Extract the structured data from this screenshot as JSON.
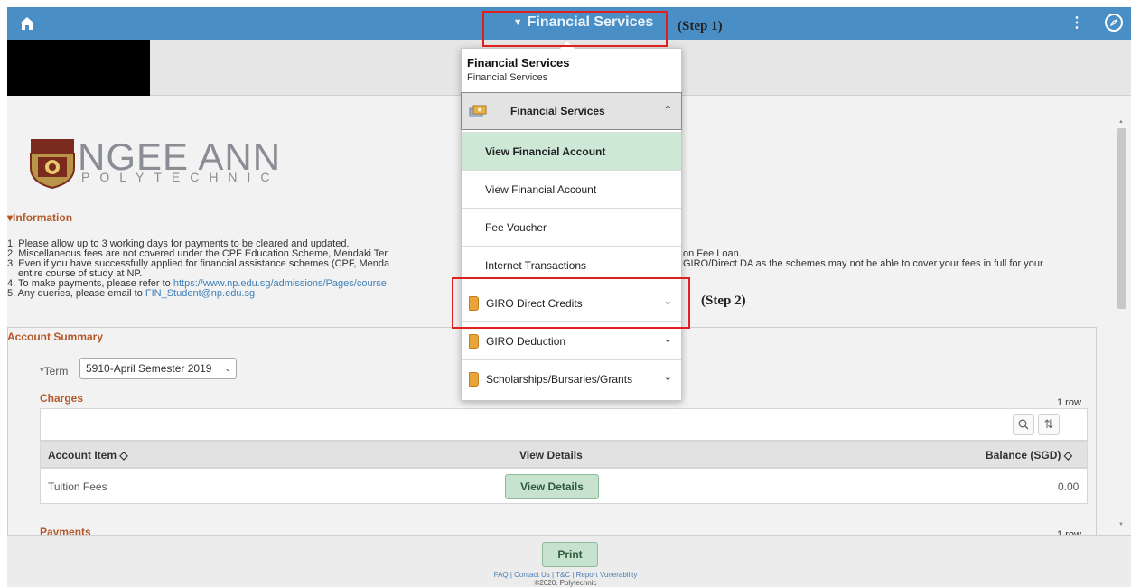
{
  "topbar": {
    "home_icon": "home-icon",
    "title": "Financial Services",
    "caret": "▼",
    "actions_icon": "kebab-menu-icon",
    "actions_glyph": "⋮",
    "navbar_icon": "compass-icon"
  },
  "annotations": {
    "step1": "(Step 1)",
    "step2": "(Step 2)"
  },
  "logo": {
    "name": "NGEE ANN",
    "subtitle": "POLYTECHNIC"
  },
  "information": {
    "header": "Information",
    "lines": [
      "1. Please allow up to 3 working days for payments to be cleared and updated.",
      "2. Miscellaneous fees are not covered under the CPF Education Scheme, Mendaki Ter",
      "3. Even if you have successfully applied for financial assistance schemes (CPF, Menda",
      "entire course of study at NP.",
      "4. To make payments, please refer to ",
      "5. Any queries, please email to "
    ],
    "line2_right": "on Fee Loan.",
    "line3_right": "GIRO/Direct DA as the schemes may not be able to cover your fees in full for your",
    "line4_link": "https://www.np.edu.sg/admissions/Pages/course",
    "line5_link": "FIN_Student@np.edu.sg"
  },
  "account_summary": {
    "title": "Account Summary",
    "term_label": "*Term",
    "term_value": "5910-April Semester 2019",
    "charges_title": "Charges",
    "charges_row_count": "1 row",
    "columns": {
      "item": "Account Item ◇",
      "details": "View Details",
      "balance": "Balance (SGD) ◇"
    },
    "rows": [
      {
        "item": "Tuition Fees",
        "button": "View Details",
        "balance": "0.00"
      }
    ],
    "payments_title": "Payments",
    "payments_row_count": "1 row"
  },
  "footer": {
    "print": "Print",
    "links": "FAQ | Contact Us | T&C | Report Vunerability",
    "copyright": "©2020. Polytechnic"
  },
  "menu": {
    "header_title": "Financial Services",
    "header_subtitle": "Financial Services",
    "section": "Financial Services",
    "items": [
      "View Financial Account",
      "View Financial Account",
      "Fee Voucher",
      "Internet Transactions"
    ],
    "folders": [
      "GIRO Direct Credits",
      "GIRO Deduction",
      "Scholarships/Bursaries/Grants"
    ]
  },
  "colors": {
    "topbar": "#4a8ec6",
    "accent_orange": "#b4582a",
    "button_green": "#c7e3cf",
    "highlight_red": "#e0201d"
  }
}
